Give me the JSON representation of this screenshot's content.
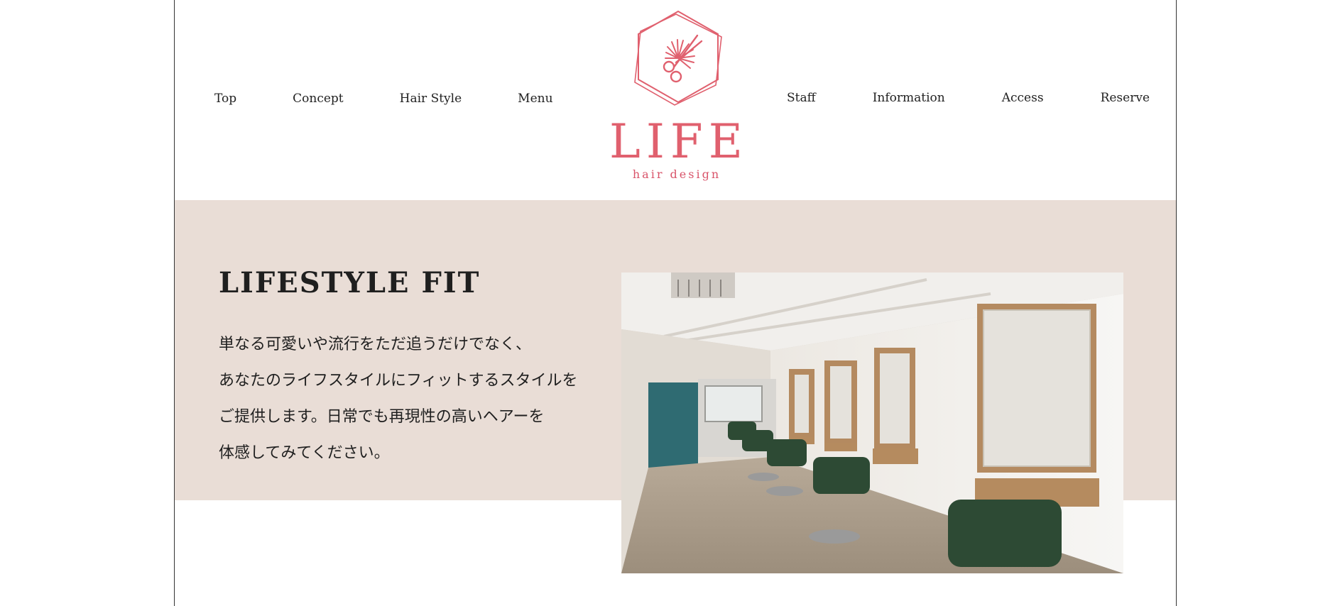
{
  "nav": {
    "left": [
      "Top",
      "Concept",
      "Hair Style",
      "Menu"
    ],
    "right": [
      "Staff",
      "Information",
      "Access",
      "Reserve"
    ]
  },
  "logo": {
    "wordmark": "LIFE",
    "tagline": "hair design",
    "icon": "scissors-hexagon-icon",
    "color": "#e0606e"
  },
  "hero": {
    "title": "LIFESTYLE FIT",
    "lines": [
      "単なる可愛いや流行をただ追うだけでなく、",
      "あなたのライフスタイルにフィットするスタイルを",
      "ご提供します。日常でも再現性の高いヘアーを",
      "体感してみてください。"
    ],
    "background": "#e9ddd6"
  }
}
